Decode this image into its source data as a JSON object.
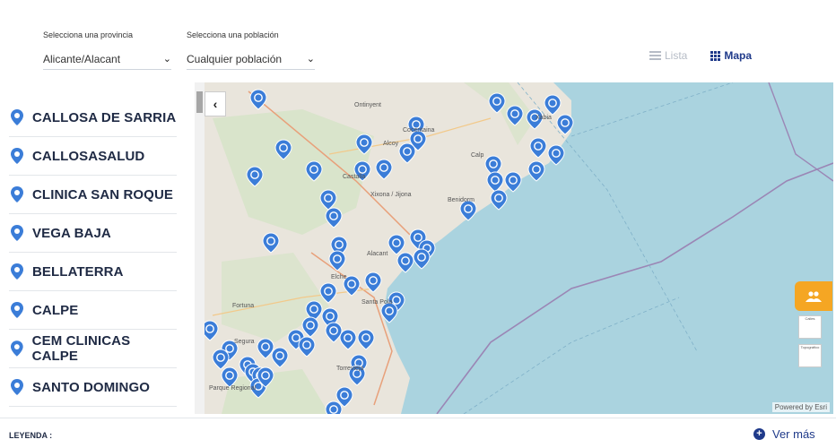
{
  "filters": {
    "provincia_label": "Selecciona una provincia",
    "provincia_value": "Alicante/Alacant",
    "poblacion_label": "Selecciona una población",
    "poblacion_value": "Cualquier población"
  },
  "view": {
    "lista_label": "Lista",
    "mapa_label": "Mapa",
    "active": "Mapa"
  },
  "centers": [
    "CALLOSA DE SARRIA",
    "CALLOSASALUD",
    "CLINICA SAN ROQUE",
    "VEGA BAJA",
    "BELLATERRA",
    "CALPE",
    "CEM CLINICAS CALPE",
    "SANTO DOMINGO"
  ],
  "map": {
    "attribution": "Powered by Esri",
    "place_labels": [
      "Ontinyent",
      "Cocentaina",
      "Alcoy",
      "Castalla",
      "Xixona / Jijona",
      "Xàbia",
      "Calp",
      "Alacant",
      "Elche",
      "Santa Pola",
      "Fortuna",
      "Segura",
      "Torrevieja",
      "Parque Regional",
      "Benidorm"
    ],
    "thumb_labels": [
      "Calles",
      "Topográfico"
    ]
  },
  "colors": {
    "accent": "#1f3a8a",
    "pin": "#3b7dd8",
    "sea": "#aad3df",
    "orange": "#f5a623"
  },
  "legend": {
    "title": "LEYENDA :",
    "more": "Ver más"
  }
}
